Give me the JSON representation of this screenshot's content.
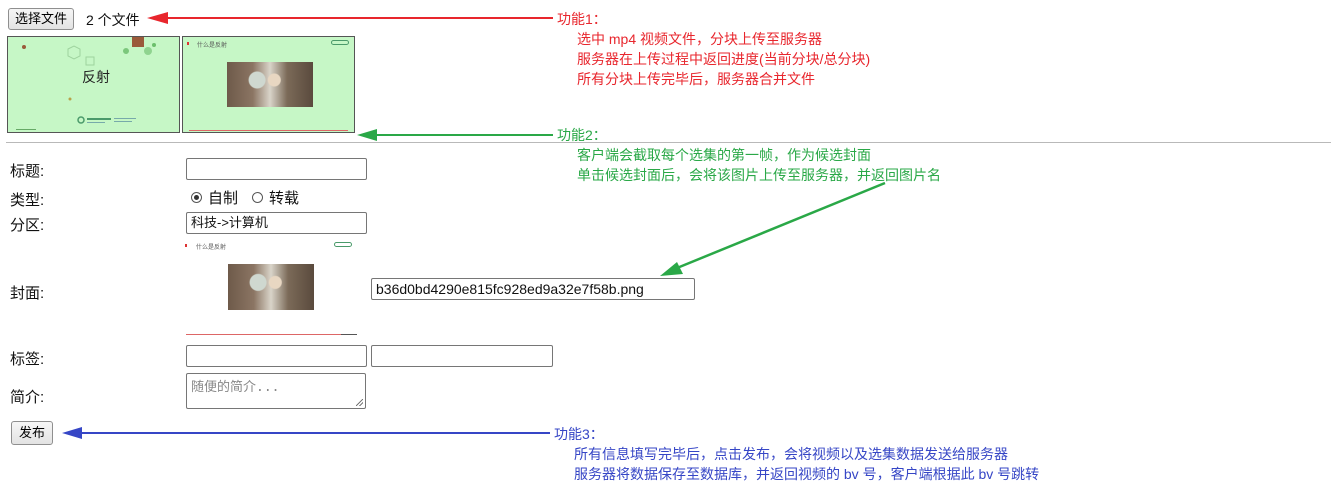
{
  "file_picker": {
    "button_label": "选择文件",
    "status": "2 个文件"
  },
  "thumbnails": {
    "first": {
      "title": "反射"
    },
    "second": {
      "caption": "什么是反射"
    }
  },
  "form": {
    "title_label": "标题:",
    "title_value": "",
    "type_label": "类型:",
    "type_options": [
      "自制",
      "转载"
    ],
    "type_selected": "自制",
    "zone_label": "分区:",
    "zone_value": "科技->计算机",
    "cover_label": "封面:",
    "cover_caption": "什么是反射",
    "cover_filename": "b36d0bd4290e815fc928ed9a32e7f58b.png",
    "tags_label": "标签:",
    "tag1_value": "",
    "tag2_value": "",
    "intro_label": "简介:",
    "intro_placeholder": "随便的简介...",
    "publish_label": "发布"
  },
  "annotations": {
    "feature1": {
      "title": "功能1：",
      "lines": [
        "选中 mp4 视频文件，分块上传至服务器",
        "服务器在上传过程中返回进度(当前分块/总分块)",
        "所有分块上传完毕后，服务器合并文件"
      ],
      "color": "#e8262d"
    },
    "feature2": {
      "title": "功能2：",
      "lines": [
        "客户端会截取每个选集的第一帧，作为候选封面",
        "单击候选封面后，会将该图片上传至服务器，并返回图片名"
      ],
      "color": "#2aa847"
    },
    "feature3": {
      "title": "功能3：",
      "lines": [
        "所有信息填写完毕后，点击发布，会将视频以及选集数据发送给服务器",
        "服务器将数据保存至数据库，并返回视频的 bv 号，客户端根据此 bv 号跳转"
      ],
      "color": "#3646c6"
    }
  }
}
